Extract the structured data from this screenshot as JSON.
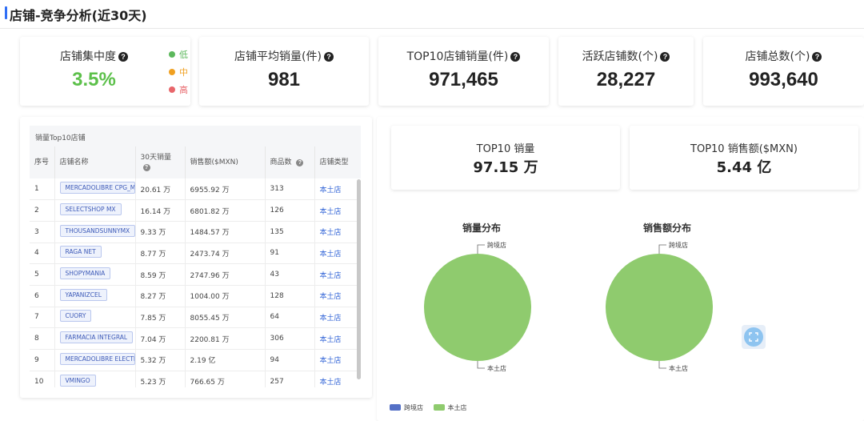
{
  "header": {
    "title": "店铺-竞争分析(近30天)"
  },
  "stats": [
    {
      "label": "店铺集中度",
      "value": "3.5%",
      "help": "?"
    },
    {
      "label": "店铺平均销量(件)",
      "value": "981",
      "help": "?"
    },
    {
      "label": "TOP10店铺销量(件)",
      "value": "971,465",
      "help": "?"
    },
    {
      "label": "活跃店铺数(个)",
      "value": "28,227",
      "help": "?"
    },
    {
      "label": "店铺总数(个)",
      "value": "993,640",
      "help": "?"
    }
  ],
  "concentration_legend": [
    {
      "label": "低",
      "color": "#5cb85c"
    },
    {
      "label": "中",
      "color": "#f0a020"
    },
    {
      "label": "高",
      "color": "#e8666b"
    }
  ],
  "colors": {
    "concentration_value": "#5cc04a",
    "local": "#8fcb6e",
    "cross_border": "#5470c6",
    "accent": "#2f6ef5"
  },
  "table": {
    "title": "销量Top10店铺",
    "headers": [
      "序号",
      "店铺名称",
      "30天销量",
      "销售额($MXN)",
      "商品数",
      "店铺类型"
    ],
    "rows": [
      [
        "1",
        "MERCADOLIBRE CPG_MX",
        "20.61 万",
        "6955.92 万",
        "313",
        "本土店"
      ],
      [
        "2",
        "SELECTSHOP MX",
        "16.14 万",
        "6801.82 万",
        "126",
        "本土店"
      ],
      [
        "3",
        "THOUSANDSUNNYMX",
        "9.33 万",
        "1484.57 万",
        "135",
        "本土店"
      ],
      [
        "4",
        "RAGA NET",
        "8.77 万",
        "2473.74 万",
        "91",
        "本土店"
      ],
      [
        "5",
        "SHOPYMANIA",
        "8.59 万",
        "2747.96 万",
        "43",
        "本土店"
      ],
      [
        "6",
        "YAPANIZCEL",
        "8.27 万",
        "1004.00 万",
        "128",
        "本土店"
      ],
      [
        "7",
        "CUORY",
        "7.85 万",
        "8055.45 万",
        "64",
        "本土店"
      ],
      [
        "8",
        "FARMACIA INTEGRAL",
        "7.04 万",
        "2200.81 万",
        "306",
        "本土店"
      ],
      [
        "9",
        "MERCADOLIBRE ELECTRONICA",
        "5.32 万",
        "2.19 亿",
        "94",
        "本土店"
      ],
      [
        "10",
        "VMINGO",
        "5.23 万",
        "766.65 万",
        "257",
        "本土店"
      ]
    ]
  },
  "top10": [
    {
      "label": "TOP10 销量",
      "value": "97.15 万"
    },
    {
      "label": "TOP10 销售额($MXN)",
      "value": "5.44 亿"
    }
  ],
  "pies": [
    {
      "title": "销量分布",
      "labels": [
        "跨境店",
        "本土店"
      ]
    },
    {
      "title": "销售额分布",
      "labels": [
        "跨境店",
        "本土店"
      ]
    }
  ],
  "chart_data": [
    {
      "type": "pie",
      "title": "销量分布",
      "categories": [
        "跨境店",
        "本土店"
      ],
      "values": [
        0,
        100
      ]
    },
    {
      "type": "pie",
      "title": "销售额分布",
      "categories": [
        "跨境店",
        "本土店"
      ],
      "values": [
        0,
        100
      ]
    }
  ],
  "legend": [
    {
      "label": "跨境店",
      "color": "#5470c6"
    },
    {
      "label": "本土店",
      "color": "#8fcb6e"
    }
  ]
}
